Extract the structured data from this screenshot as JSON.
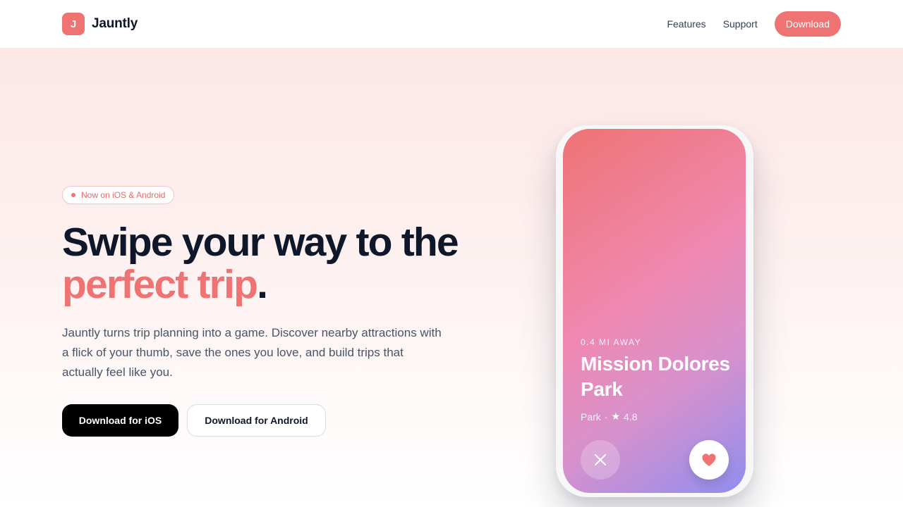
{
  "brand": {
    "initial": "J",
    "name": "Jauntly"
  },
  "nav": {
    "links": [
      "Features",
      "Support"
    ],
    "download_label": "Download"
  },
  "hero": {
    "badge": "Now on iOS & Android",
    "headline_part1": "Swipe your way to the ",
    "headline_accent": "perfect trip",
    "headline_end": ".",
    "subtext": "Jauntly turns trip planning into a game. Discover nearby attractions with a flick of your thumb, save the ones you love, and build trips that actually feel like you.",
    "cta_ios": "Download for iOS",
    "cta_android": "Download for Android"
  },
  "card": {
    "distance": "0.4 MI AWAY",
    "title": "Mission Dolores Park",
    "category": "Park",
    "separator": "·",
    "rating": "4.8",
    "skip_icon": "close-icon",
    "like_icon": "heart-icon"
  },
  "colors": {
    "accent": "#ef7373",
    "text_dark": "#0f172a",
    "text_muted": "#475569"
  }
}
